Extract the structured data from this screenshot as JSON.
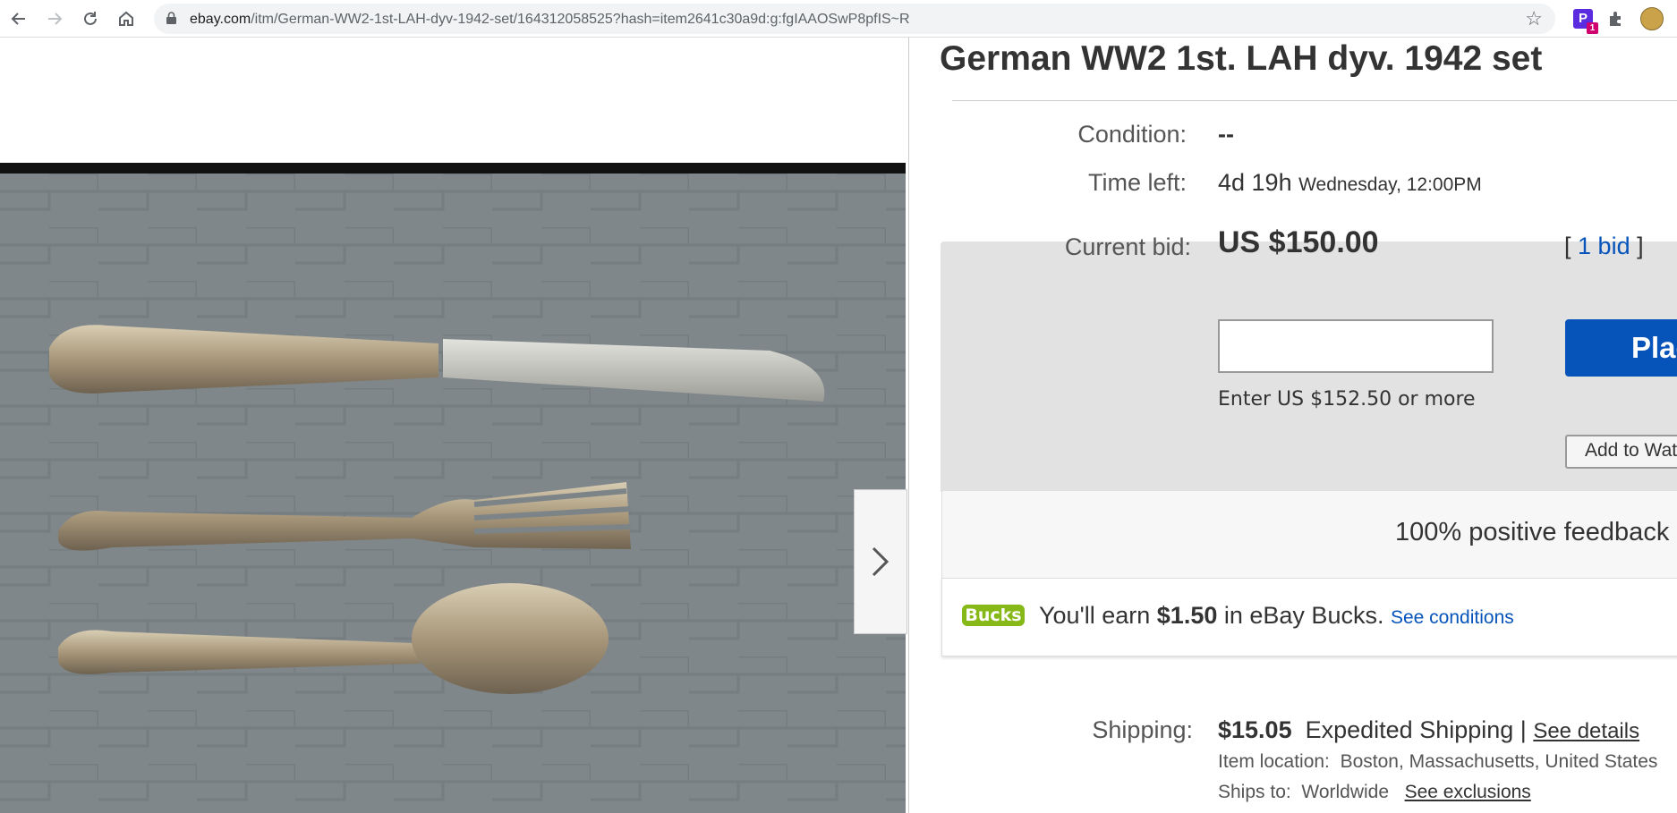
{
  "browser": {
    "url_host": "ebay.com",
    "url_path": "/itm/German-WW2-1st-LAH-dyv-1942-set/164312058525?hash=item2641c30a9d:g:fgIAAOSwP8pfIS~R",
    "ext_badge": "1"
  },
  "item": {
    "title": "German WW2 1st. LAH dyv. 1942 set",
    "condition_label": "Condition:",
    "condition_value": "--",
    "time_left_label": "Time left:",
    "time_left_value": "4d 19h",
    "time_left_end": "Wednesday, 12:00PM"
  },
  "bid": {
    "current_bid_label": "Current bid:",
    "current_bid_value": "US $150.00",
    "bracket_open": "[",
    "bid_count": "1 bid",
    "bracket_close": "]",
    "input_value": "",
    "hint": "Enter US $152.50 or more",
    "place_bid_label": "Place bid",
    "add_watchlist_label": "Add to Watchlist"
  },
  "feedback": {
    "text": "100% positive feedback"
  },
  "bucks": {
    "logo_text": "Bucks",
    "earn_prefix": "You'll earn",
    "earn_amount": "$1.50",
    "earn_suffix": "in eBay Bucks.",
    "see_conditions": "See conditions"
  },
  "shipping": {
    "label": "Shipping:",
    "price": "$15.05",
    "method": "Expedited Shipping |",
    "see_details": "See details",
    "location_label": "Item location:",
    "location_value": "Boston, Massachusetts, United States",
    "ships_to_label": "Ships to:",
    "ships_to_value": "Worldwide",
    "see_exclusions": "See exclusions"
  },
  "colors": {
    "link_blue": "#0654ba",
    "bucks_green": "#86b817",
    "bid_panel_gray": "#e2e2e2"
  }
}
